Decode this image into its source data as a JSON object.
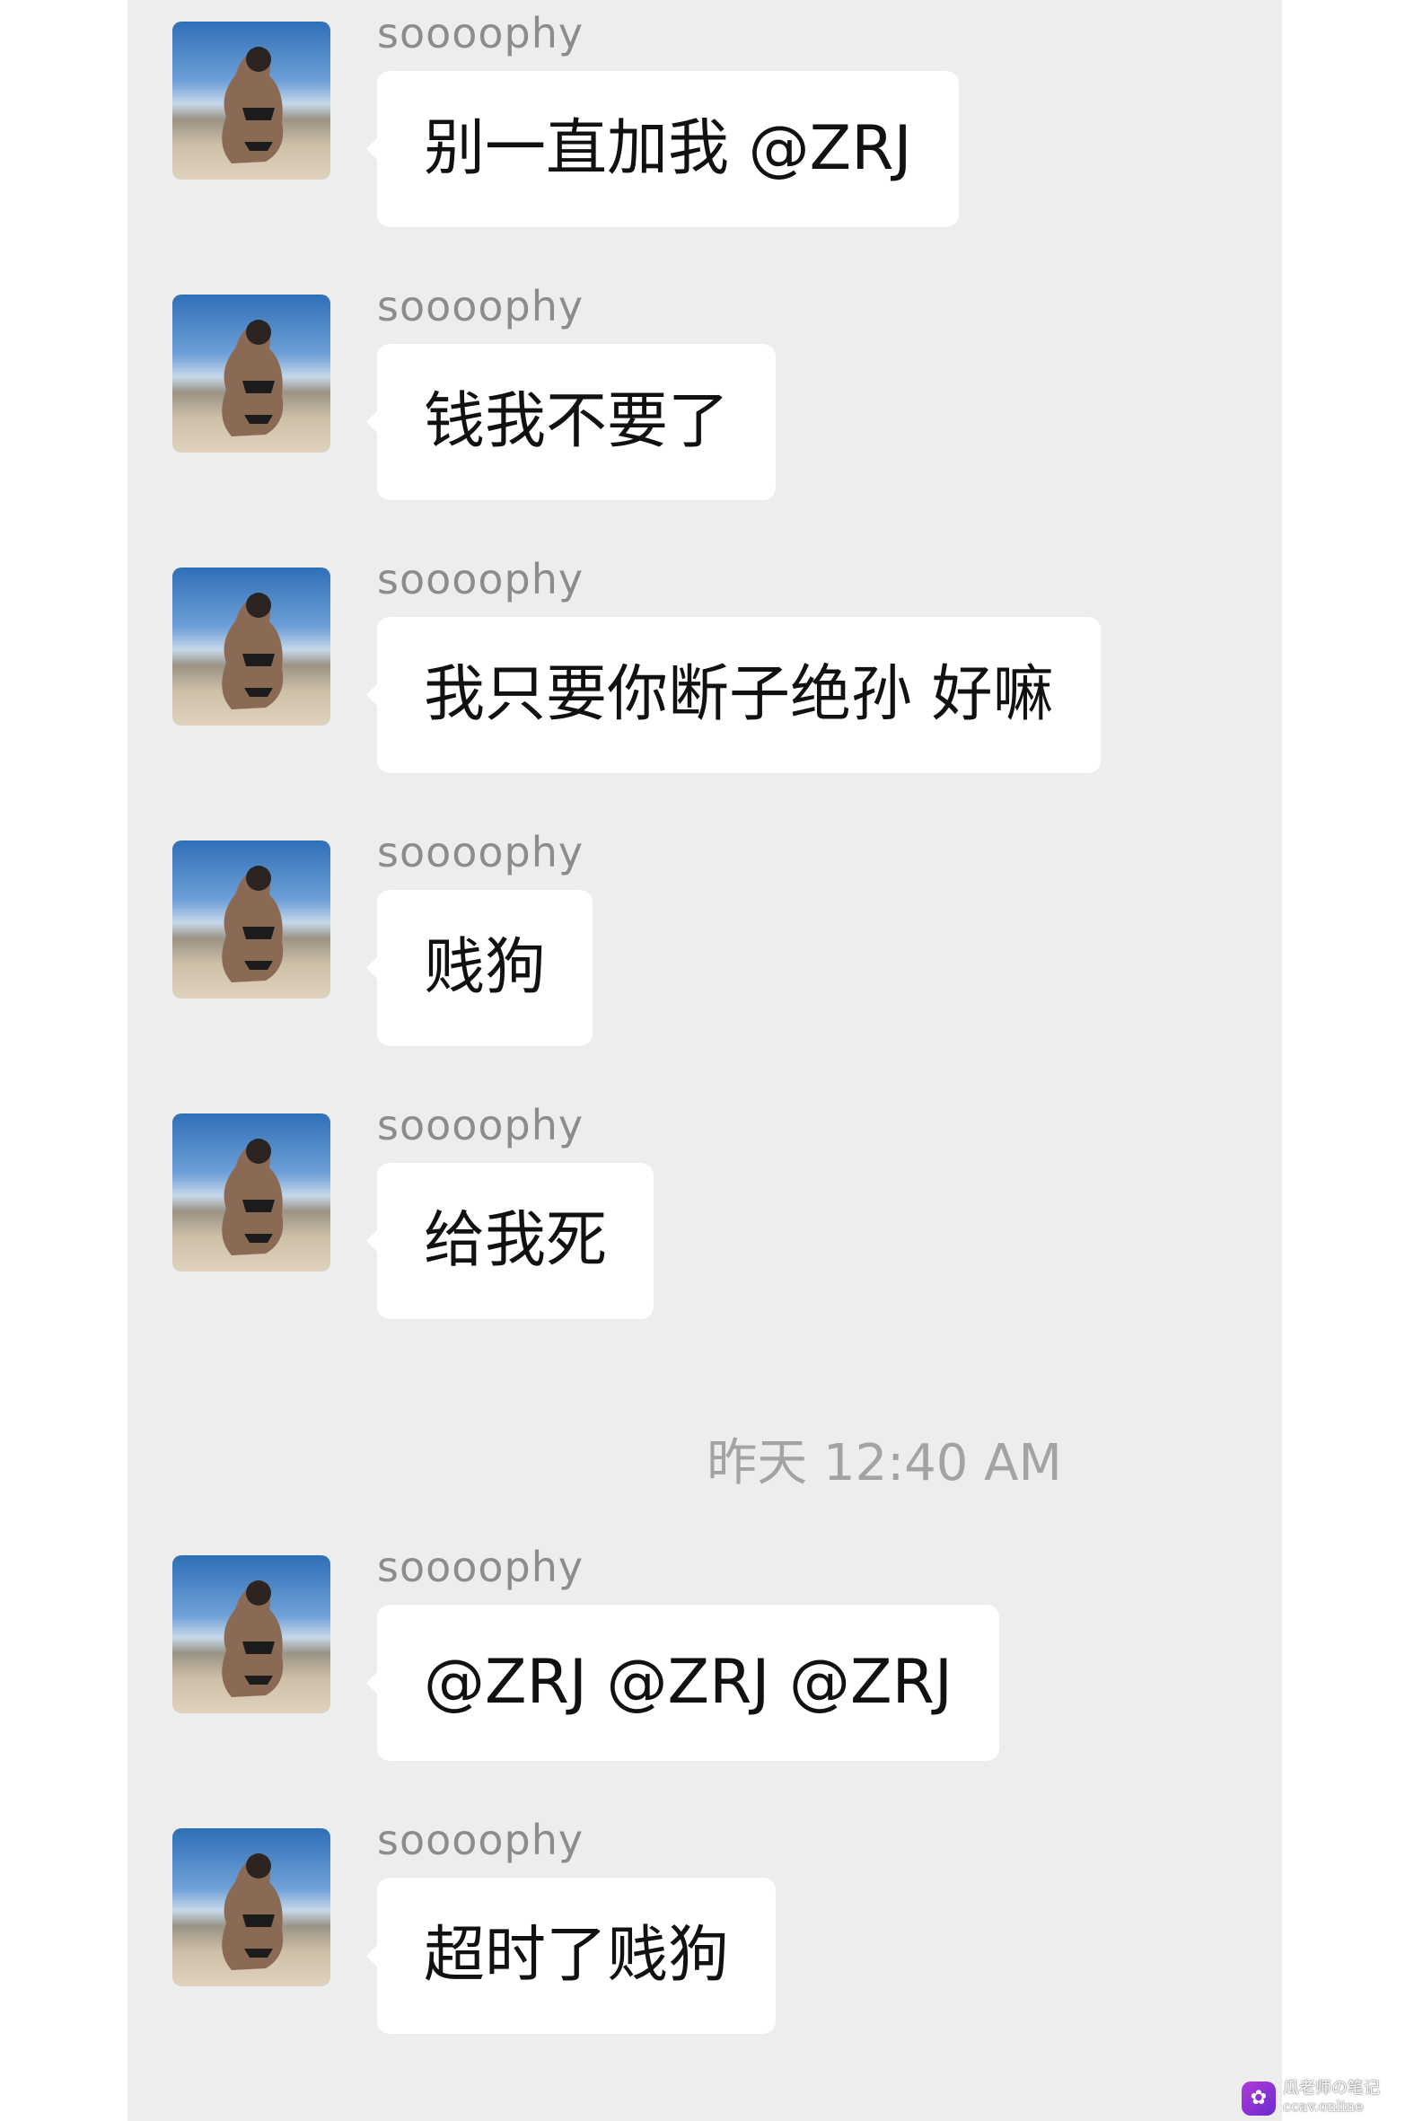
{
  "timestamp": "昨天 12:40 AM",
  "messages": [
    {
      "sender": "soooophy",
      "text": "别一直加我 @ZRJ"
    },
    {
      "sender": "soooophy",
      "text": "钱我不要了"
    },
    {
      "sender": "soooophy",
      "text": "我只要你断子绝孙 好嘛"
    },
    {
      "sender": "soooophy",
      "text": "贱狗"
    },
    {
      "sender": "soooophy",
      "text": "给我死"
    },
    {
      "sender": "soooophy",
      "text": "@ZRJ @ZRJ @ZRJ"
    },
    {
      "sender": "soooophy",
      "text": "超时了贱狗"
    }
  ],
  "watermark": {
    "line1": "瓜老师の笔记",
    "line2": "ccav.online"
  },
  "colors": {
    "chat_bg": "#ededed",
    "bubble_bg": "#ffffff",
    "sender": "#8c8c8c",
    "timestamp": "#a3a3a3"
  }
}
